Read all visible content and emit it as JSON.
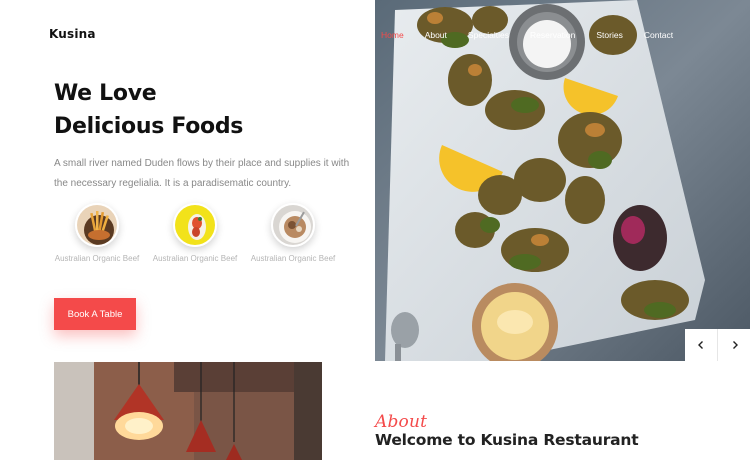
{
  "brand": "Kusina",
  "nav": {
    "items": [
      {
        "label": "Home",
        "active": true
      },
      {
        "label": "About",
        "active": false
      },
      {
        "label": "Specialties",
        "active": false
      },
      {
        "label": "Reservation",
        "active": false
      },
      {
        "label": "Stories",
        "active": false
      },
      {
        "label": "Contact",
        "active": false
      }
    ]
  },
  "hero": {
    "title_line1": "We Love",
    "title_line2": "Delicious Foods",
    "text": "A small river named Duden flows by their place and supplies it with the necessary regelialia. It is a paradisematic country.",
    "features": [
      {
        "label": "Australian Organic Beef",
        "icon": "fries-dish-photo"
      },
      {
        "label": "Australian Organic Beef",
        "icon": "yellow-plate-dish-photo"
      },
      {
        "label": "Australian Organic Beef",
        "icon": "white-bowl-dish-photo"
      }
    ],
    "book_button": "Book A Table",
    "image": "fried-herbs-platter-photo"
  },
  "slider": {
    "prev_icon": "chevron-left-icon",
    "next_icon": "chevron-right-icon"
  },
  "about": {
    "script": "About",
    "heading": "Welcome to Kusina Restaurant",
    "image": "hanging-lamps-photo"
  },
  "colors": {
    "accent": "#f44a4a",
    "text_dark": "#111111",
    "text_muted": "#888888"
  }
}
